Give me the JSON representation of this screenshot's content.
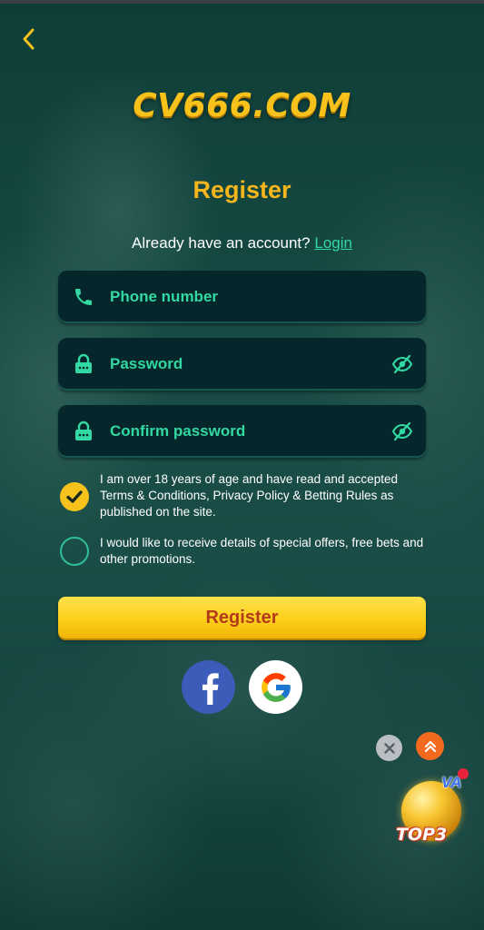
{
  "header": {
    "logo_text": "CV666.COM"
  },
  "title": "Register",
  "login_prompt": {
    "text": "Already have an account?",
    "link": "Login"
  },
  "fields": {
    "phone": {
      "placeholder": "Phone number",
      "icon": "phone-icon"
    },
    "password": {
      "placeholder": "Password",
      "icon": "lock-icon",
      "toggle_icon": "eye-off-icon"
    },
    "confirm": {
      "placeholder": "Confirm password",
      "icon": "lock-icon",
      "toggle_icon": "eye-off-icon"
    }
  },
  "agreements": [
    {
      "checked": true,
      "text": "I am over 18 years of age and have read and accepted Terms & Conditions, Privacy Policy & Betting Rules as published on the site."
    },
    {
      "checked": false,
      "text": "I would like to receive details of special offers, free bets and other promotions."
    }
  ],
  "register_button": "Register",
  "social": [
    {
      "name": "Facebook",
      "icon": "facebook-icon"
    },
    {
      "name": "Google",
      "icon": "google-icon"
    }
  ],
  "promo": {
    "badge": "VA",
    "label": "TOP3"
  },
  "colors": {
    "accent": "#f5b51c",
    "link": "#32d9a2",
    "button_text": "#b33a1a",
    "background": "#0f3b36"
  }
}
